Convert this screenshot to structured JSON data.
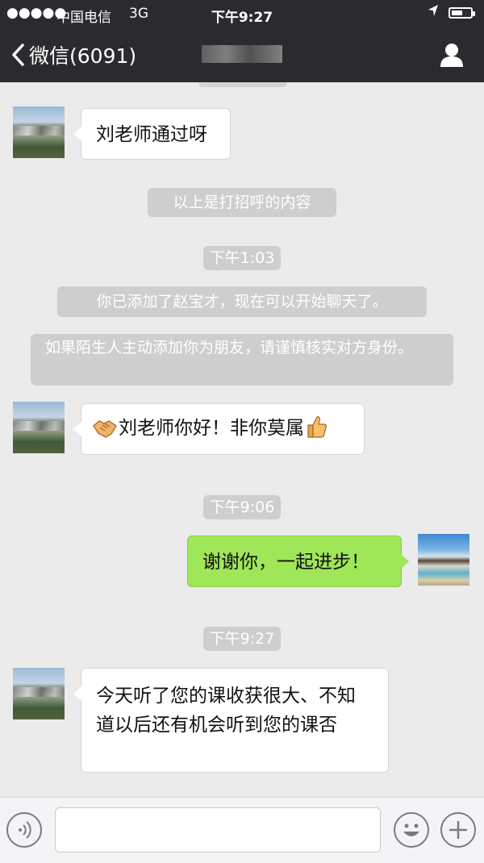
{
  "status_bar": {
    "signal": "●●●●●",
    "carrier": "中国电信",
    "network": "3G",
    "time": "下午9:27",
    "battery_level": 0.6
  },
  "nav": {
    "back_label": "微信(6091)",
    "back_icon": "chevron-left-icon",
    "profile_icon": "person-icon"
  },
  "messages": {
    "m1": "刘老师通过呀",
    "sys1": "以上是打招呼的内容",
    "ts1": "下午1:03",
    "sys2": "你已添加了赵宝才，现在可以开始聊天了。",
    "sys3": "如果陌生人主动添加你为朋友，请谨慎核实对方身份。",
    "m2": "刘老师你好！非你莫属",
    "ts2": "下午9:06",
    "m3": "谢谢你，一起进步！",
    "ts3": "下午9:27",
    "m4": "今天听了您的课收获很大、不知道以后还有机会听到您的课否"
  },
  "input": {
    "voice_icon": "voice-icon",
    "emoji_icon": "smiley-icon",
    "plus_icon": "plus-icon",
    "value": ""
  },
  "colors": {
    "nav_bg": "#2b2b2f",
    "chat_bg": "#ebebeb",
    "sent_bubble": "#9fe658",
    "system_tag": "#cecece"
  }
}
